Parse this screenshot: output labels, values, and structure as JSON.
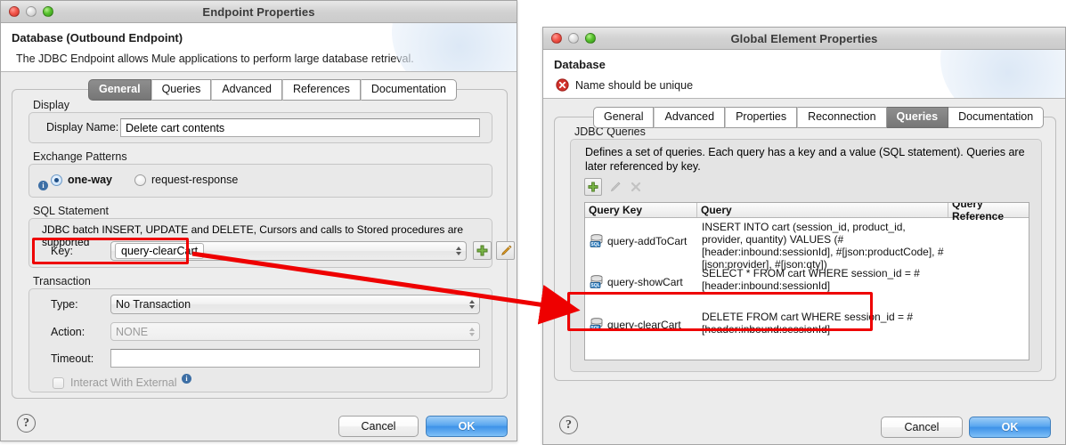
{
  "left_window": {
    "title": "Endpoint Properties",
    "traffic_lights": [
      "close-red",
      "minimize-gray",
      "zoom-green"
    ],
    "banner": {
      "title": "Database (Outbound Endpoint)",
      "description": "The JDBC Endpoint allows Mule applications to perform large database retrieval."
    },
    "tabs": [
      {
        "label": "General",
        "selected": true
      },
      {
        "label": "Queries",
        "selected": false
      },
      {
        "label": "Advanced",
        "selected": false
      },
      {
        "label": "References",
        "selected": false
      },
      {
        "label": "Documentation",
        "selected": false
      }
    ],
    "display_section": {
      "group_label": "Display",
      "display_name_label": "Display Name:",
      "display_name_value": "Delete cart contents"
    },
    "exchange_section": {
      "group_label": "Exchange Patterns",
      "info_icon": "info-icon",
      "options": [
        {
          "label": "one-way",
          "selected": true
        },
        {
          "label": "request-response",
          "selected": false
        }
      ]
    },
    "sql_section": {
      "group_label": "SQL Statement",
      "hint": "JDBC batch INSERT, UPDATE and DELETE, Cursors and calls to Stored procedures are supported",
      "key_label": "Key:",
      "key_value": "query-clearCart",
      "add_button_icon": "plus-icon",
      "edit_button_icon": "pencil-icon"
    },
    "transaction_section": {
      "group_label": "Transaction",
      "type_label": "Type:",
      "type_value": "No Transaction",
      "action_label": "Action:",
      "action_value": "NONE",
      "action_disabled": true,
      "timeout_label": "Timeout:",
      "timeout_value": "",
      "interact_label": "Interact With External",
      "interact_checked": false,
      "interact_info_icon": "info-icon"
    },
    "footer": {
      "help_label": "?",
      "cancel_label": "Cancel",
      "ok_label": "OK"
    }
  },
  "right_window": {
    "title": "Global Element Properties",
    "traffic_lights": [
      "close-red",
      "minimize-gray",
      "zoom-green"
    ],
    "banner": {
      "title": "Database",
      "error_icon": "error-icon",
      "error_message": "Name should be unique"
    },
    "tabs": [
      {
        "label": "General",
        "selected": false
      },
      {
        "label": "Advanced",
        "selected": false
      },
      {
        "label": "Properties",
        "selected": false
      },
      {
        "label": "Reconnection",
        "selected": false
      },
      {
        "label": "Queries",
        "selected": true
      },
      {
        "label": "Documentation",
        "selected": false
      }
    ],
    "queries_section": {
      "group_label": "JDBC Queries",
      "description": "Defines a set of queries. Each query has a key and a value (SQL statement). Queries are later referenced by key.",
      "toolbar": [
        {
          "name": "add-query-button",
          "icon": "plus-icon",
          "enabled": true
        },
        {
          "name": "edit-query-button",
          "icon": "pencil-icon",
          "enabled": false
        },
        {
          "name": "delete-query-button",
          "icon": "delete-icon",
          "enabled": false
        }
      ],
      "table": {
        "columns": [
          "Query Key",
          "Query",
          "Query Reference"
        ],
        "rows": [
          {
            "icon": "sql-icon",
            "key": "query-addToCart",
            "query": "INSERT INTO cart (session_id, product_id, provider, quantity) VALUES (#[header:inbound:sessionId], #[json:productCode], #[json:provider], #[json:qty])",
            "reference": "",
            "highlighted": false
          },
          {
            "icon": "sql-icon",
            "key": "query-showCart",
            "query": "SELECT * FROM cart WHERE session_id = #[header:inbound:sessionId]",
            "reference": "",
            "highlighted": false
          },
          {
            "icon": "sql-icon",
            "key": "query-clearCart",
            "query": "DELETE FROM cart WHERE session_id = #[header:inbound:sessionId]",
            "reference": "",
            "highlighted": true
          }
        ]
      }
    },
    "footer": {
      "help_label": "?",
      "cancel_label": "Cancel",
      "ok_label": "OK"
    }
  },
  "annotations": {
    "highlight_color": "#ee0000",
    "arrow_color": "#ee0000",
    "boxes": [
      {
        "name": "key-field-highlight",
        "target": "left.sql_section.key"
      },
      {
        "name": "clearcart-row-highlight",
        "target": "right.table.row.query-clearCart"
      }
    ],
    "arrow": {
      "name": "key-to-row-arrow",
      "from": "key-field-highlight",
      "to": "clearcart-row-highlight"
    }
  }
}
